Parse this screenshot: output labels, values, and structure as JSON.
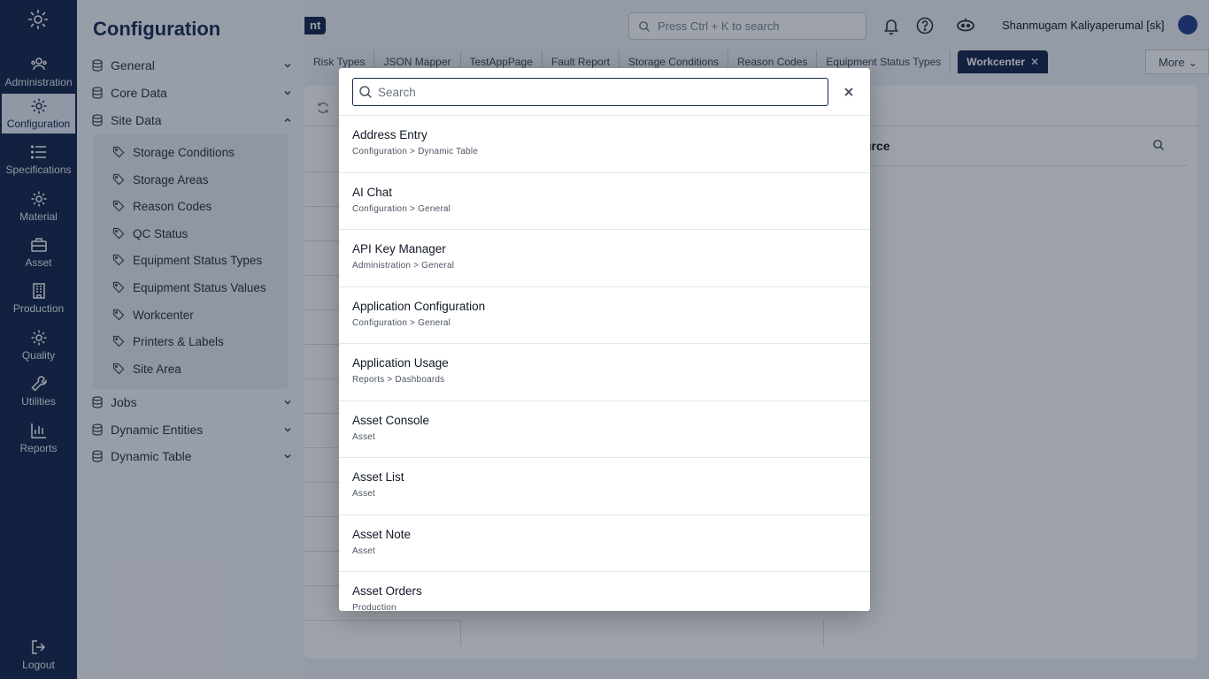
{
  "rail": {
    "items": [
      {
        "label": "Administration",
        "icon": "user-group-icon"
      },
      {
        "label": "Configuration",
        "icon": "gear-icon",
        "active": true
      },
      {
        "label": "Specifications",
        "icon": "list-icon"
      },
      {
        "label": "Material",
        "icon": "gear-icon"
      },
      {
        "label": "Asset",
        "icon": "briefcase-icon"
      },
      {
        "label": "Production",
        "icon": "building-icon"
      },
      {
        "label": "Quality",
        "icon": "gear-icon"
      },
      {
        "label": "Utilities",
        "icon": "wrench-icon"
      },
      {
        "label": "Reports",
        "icon": "bar-chart-icon"
      }
    ],
    "logout": "Logout"
  },
  "sidemenu": {
    "title": "Configuration",
    "groups": [
      {
        "label": "General"
      },
      {
        "label": "Core Data"
      },
      {
        "label": "Site Data"
      },
      {
        "label": "Jobs"
      },
      {
        "label": "Dynamic Entities"
      },
      {
        "label": "Dynamic Table"
      }
    ],
    "site_data_items": [
      "Storage Conditions",
      "Storage Areas",
      "Reason Codes",
      "QC Status",
      "Equipment Status Types",
      "Equipment Status Values",
      "Workcenter",
      "Printers & Labels",
      "Site Area"
    ]
  },
  "header": {
    "badge": "nt",
    "search_placeholder": "Press Ctrl + K to search",
    "user": "Shanmugam Kaliyaperumal [sk]"
  },
  "tabs": {
    "items": [
      "Risk Types",
      "JSON Mapper",
      "TestAppPage",
      "Fault Report",
      "Storage Conditions",
      "Reason Codes",
      "Equipment Status Types"
    ],
    "active": "Workcenter",
    "more": "More"
  },
  "panel": {
    "column_title": "urce"
  },
  "modal": {
    "search_placeholder": "Search",
    "results": [
      {
        "title": "Address Entry",
        "path": "Configuration > Dynamic Table"
      },
      {
        "title": "AI Chat",
        "path": "Configuration > General"
      },
      {
        "title": "API Key Manager",
        "path": "Administration > General"
      },
      {
        "title": "Application Configuration",
        "path": "Configuration > General"
      },
      {
        "title": "Application Usage",
        "path": "Reports > Dashboards"
      },
      {
        "title": "Asset Console",
        "path": "Asset"
      },
      {
        "title": "Asset List",
        "path": "Asset"
      },
      {
        "title": "Asset Note",
        "path": "Asset"
      },
      {
        "title": "Asset Orders",
        "path": "Production"
      }
    ]
  },
  "colors": {
    "navy": "#0f1f45",
    "sidemenu_bg": "#f4f6fa",
    "overlay": "rgba(25,35,55,0.42)"
  }
}
